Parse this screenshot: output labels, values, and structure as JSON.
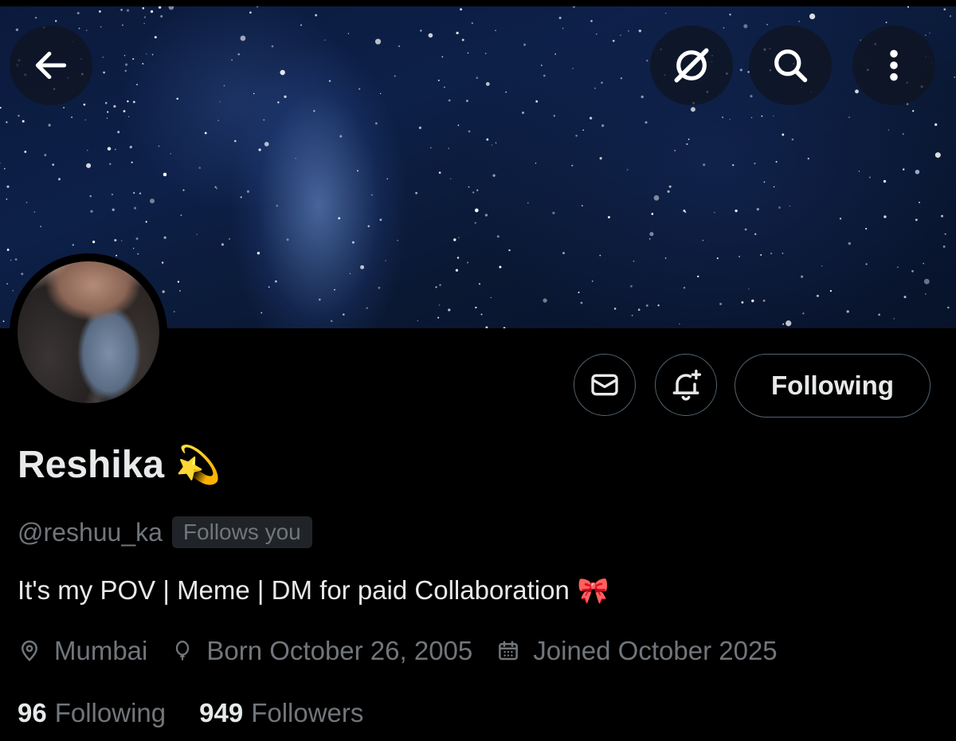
{
  "header": {
    "back_icon": "arrow-left-icon",
    "grok_icon": "grok-icon",
    "search_icon": "search-icon",
    "more_icon": "more-vertical-icon"
  },
  "profile": {
    "name": "Reshika",
    "name_emoji": "💫",
    "handle": "@reshuu_ka",
    "follows_you": "Follows you",
    "bio": "It's my POV | Meme | DM for paid Collaboration",
    "bio_emoji": "🎀",
    "location": "Mumbai",
    "birthday": "Born October 26, 2005",
    "joined": "Joined October 2025"
  },
  "actions": {
    "message_icon": "mail-icon",
    "notify_icon": "bell-plus-icon",
    "follow_label": "Following"
  },
  "stats": {
    "following_count": "96",
    "following_label": "Following",
    "followers_count": "949",
    "followers_label": "Followers"
  },
  "colors": {
    "background": "#000000",
    "text_primary": "#e7e9ea",
    "text_secondary": "#71767b",
    "border": "#536471",
    "badge_bg": "#202327"
  }
}
